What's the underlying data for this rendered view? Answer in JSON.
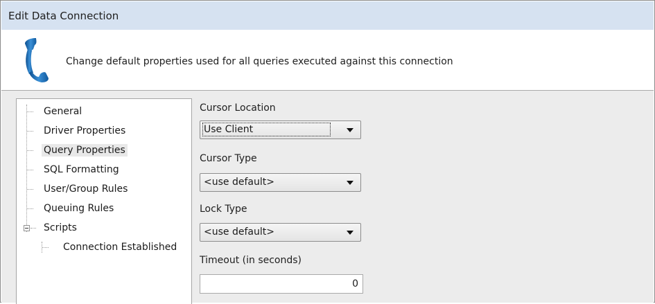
{
  "window": {
    "title": "Edit Data Connection"
  },
  "banner": {
    "icon": "phone-handset-icon",
    "description": "Change default properties used for all queries executed against this connection"
  },
  "tree": {
    "items": [
      {
        "label": "General"
      },
      {
        "label": "Driver Properties"
      },
      {
        "label": "Query Properties",
        "selected": true
      },
      {
        "label": "SQL Formatting"
      },
      {
        "label": "User/Group Rules"
      },
      {
        "label": "Queuing Rules"
      },
      {
        "label": "Scripts",
        "expanded": true
      },
      {
        "label": "Connection Established"
      }
    ]
  },
  "form": {
    "cursor_location": {
      "label": "Cursor Location",
      "value": "Use Client"
    },
    "cursor_type": {
      "label": "Cursor Type",
      "value": "<use default>"
    },
    "lock_type": {
      "label": "Lock Type",
      "value": "<use default>"
    },
    "timeout": {
      "label": "Timeout (in seconds)",
      "value": "0"
    }
  },
  "colors": {
    "titlebar_bg": "#d6e2f1",
    "panel_bg": "#ececec",
    "icon_blue": "#1f6fb5"
  }
}
